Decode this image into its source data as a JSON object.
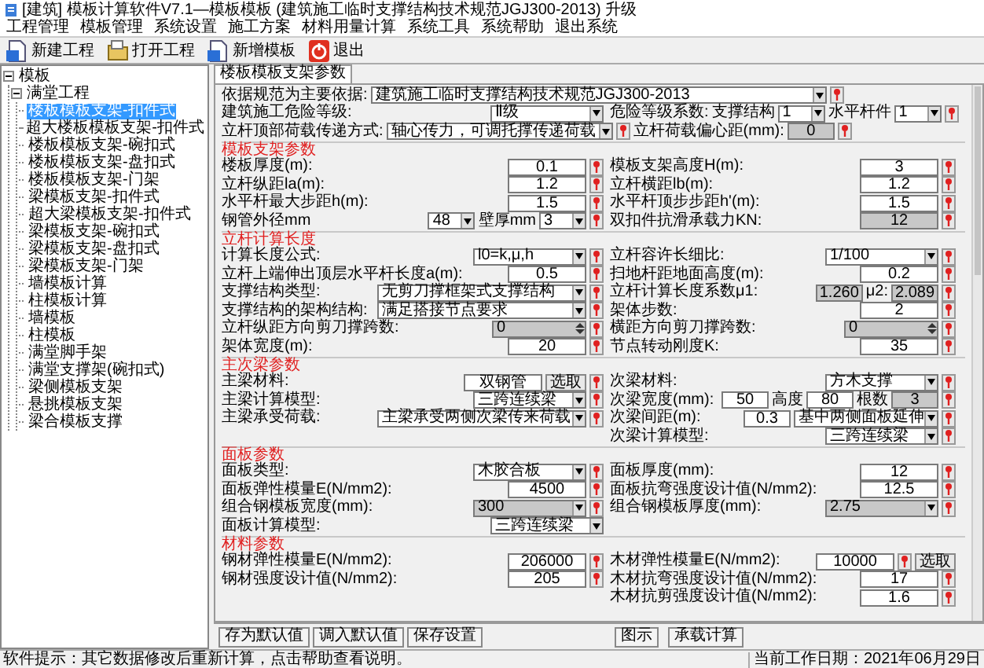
{
  "window": {
    "title": "[建筑] 模板计算软件V7.1—模板模板 (建筑施工临时支撑结构技术规范JGJ300-2013) 升级"
  },
  "menu": [
    "工程管理",
    "模板管理",
    "系统设置",
    "施工方案",
    "材料用量计算",
    "系统工具",
    "系统帮助",
    "退出系统"
  ],
  "toolbar": [
    {
      "kind": "new",
      "label": "新建工程"
    },
    {
      "kind": "open",
      "label": "打开工程"
    },
    {
      "kind": "new",
      "label": "新增模板"
    },
    {
      "kind": "exit",
      "label": "退出"
    }
  ],
  "tree": [
    {
      "label": "模板",
      "expanded": true,
      "selected": false,
      "children": [
        {
          "label": "满堂工程",
          "expanded": true,
          "selected": false,
          "children": [
            {
              "label": "楼板模板支架-扣件式",
              "selected": true
            },
            {
              "label": "超大楼板模板支架-扣件式",
              "selected": false
            },
            {
              "label": "楼板模板支架-碗扣式",
              "selected": false
            },
            {
              "label": "楼板模板支架-盘扣式",
              "selected": false
            },
            {
              "label": "楼板模板支架-门架",
              "selected": false
            },
            {
              "label": "梁模板支架-扣件式",
              "selected": false
            },
            {
              "label": "超大梁模板支架-扣件式",
              "selected": false
            },
            {
              "label": "梁模板支架-碗扣式",
              "selected": false
            },
            {
              "label": "梁模板支架-盘扣式",
              "selected": false
            },
            {
              "label": "梁模板支架-门架",
              "selected": false
            },
            {
              "label": "墙模板计算",
              "selected": false
            },
            {
              "label": "柱模板计算",
              "selected": false
            },
            {
              "label": "墙模板",
              "selected": false
            },
            {
              "label": "柱模板",
              "selected": false
            },
            {
              "label": "满堂脚手架",
              "selected": false
            },
            {
              "label": "满堂支撑架(碗扣式)",
              "selected": false
            },
            {
              "label": "梁侧模板支架",
              "selected": false
            },
            {
              "label": "悬挑模板支架",
              "selected": false
            },
            {
              "label": "梁合模板支撑",
              "selected": false
            }
          ]
        }
      ]
    }
  ],
  "tab": {
    "label": "楼板模板支架参数",
    "selected": true
  },
  "sections": [
    {
      "rows": [
        {
          "full": [
            {
              "kind": "label",
              "text": "依据规范为主要依据:"
            },
            {
              "kind": "fullselect",
              "value": "建筑施工临时支撑结构技术规范JGJ300-2013",
              "disabled": false
            },
            {
              "kind": "help"
            }
          ]
        },
        {
          "left": [
            {
              "kind": "label",
              "text": "建筑施工危险等级:"
            },
            {
              "kind": "select",
              "value": "Ⅱ级",
              "disabled": false
            }
          ],
          "right": [
            {
              "kind": "label",
              "text": "危险等级系数:"
            },
            {
              "kind": "label",
              "text": "支撑结构"
            },
            {
              "kind": "tinyselect",
              "value": "1",
              "disabled": false
            },
            {
              "kind": "label",
              "text": "水平杆件"
            },
            {
              "kind": "tinyselect",
              "value": "1",
              "disabled": false
            },
            {
              "kind": "help"
            }
          ]
        },
        {
          "full": [
            {
              "kind": "label",
              "text": "立杆顶部荷载传递方式:"
            },
            {
              "kind": "longselect",
              "value": "轴心传力，可调托撑传递荷载",
              "disabled": false
            },
            {
              "kind": "help"
            },
            {
              "kind": "label",
              "text": "立杆荷载偏心距(mm):"
            },
            {
              "kind": "tiny",
              "value": "0",
              "disabled": true
            },
            {
              "kind": "help"
            }
          ]
        }
      ]
    },
    {
      "heading": "模板支架参数",
      "rows": [
        {
          "left": [
            {
              "kind": "label",
              "text": "楼板厚度(m):"
            },
            {
              "kind": "field",
              "value": "0.1",
              "disabled": false
            },
            {
              "kind": "help"
            }
          ],
          "right": [
            {
              "kind": "label",
              "text": "模板支架高度H(m):"
            },
            {
              "kind": "field",
              "value": "3",
              "disabled": false
            },
            {
              "kind": "help"
            }
          ]
        },
        {
          "left": [
            {
              "kind": "label",
              "text": "立杆纵距la(m):"
            },
            {
              "kind": "field",
              "value": "1.2",
              "disabled": false
            },
            {
              "kind": "help"
            }
          ],
          "right": [
            {
              "kind": "label",
              "text": "立杆横距lb(m):"
            },
            {
              "kind": "field",
              "value": "1.2",
              "disabled": false
            },
            {
              "kind": "help"
            }
          ]
        },
        {
          "left": [
            {
              "kind": "label",
              "text": "水平杆最大步距h(m):"
            },
            {
              "kind": "field",
              "value": "1.5",
              "disabled": false
            },
            {
              "kind": "help"
            }
          ],
          "right": [
            {
              "kind": "label",
              "text": "水平杆顶步步距h'(m):"
            },
            {
              "kind": "field",
              "value": "1.5",
              "disabled": false
            },
            {
              "kind": "help"
            }
          ]
        },
        {
          "left": [
            {
              "kind": "label",
              "text": "钢管外径mm"
            },
            {
              "kind": "tinyselect",
              "value": "48",
              "disabled": false
            },
            {
              "kind": "label",
              "text": "壁厚mm"
            },
            {
              "kind": "tinyselect",
              "value": "3",
              "disabled": false
            },
            {
              "kind": "help"
            }
          ],
          "right": [
            {
              "kind": "label",
              "text": "双扣件抗滑承载力KN:"
            },
            {
              "kind": "field",
              "value": "12",
              "disabled": true
            },
            {
              "kind": "help"
            }
          ]
        }
      ]
    },
    {
      "heading": "立杆计算长度",
      "rows": [
        {
          "left": [
            {
              "kind": "label",
              "text": "计算长度公式:"
            },
            {
              "kind": "select",
              "value": "l0=k,μ,h",
              "disabled": false
            },
            {
              "kind": "help"
            }
          ],
          "right": [
            {
              "kind": "label",
              "text": "立杆容许长细比:"
            },
            {
              "kind": "select",
              "value": "1/100",
              "disabled": false
            },
            {
              "kind": "help"
            }
          ]
        },
        {
          "left": [
            {
              "kind": "label",
              "text": "立杆上端伸出顶层水平杆长度a(m):"
            },
            {
              "kind": "field",
              "value": "0.5",
              "disabled": false
            },
            {
              "kind": "help"
            }
          ],
          "right": [
            {
              "kind": "label",
              "text": "扫地杆距地面高度(m):"
            },
            {
              "kind": "field",
              "value": "0.2",
              "disabled": false
            },
            {
              "kind": "help"
            }
          ]
        },
        {
          "left": [
            {
              "kind": "label",
              "text": "支撑结构类型:"
            },
            {
              "kind": "wideselect",
              "value": "无剪刀撑框架式支撑结构",
              "disabled": false
            },
            {
              "kind": "help"
            }
          ],
          "right": [
            {
              "kind": "label",
              "text": "立杆计算长度系数μ1:"
            },
            {
              "kind": "tiny",
              "value": "1.260",
              "disabled": true
            },
            {
              "kind": "label",
              "text": "μ2:"
            },
            {
              "kind": "tiny",
              "value": "2.089",
              "disabled": true
            },
            {
              "kind": "help"
            }
          ]
        },
        {
          "left": [
            {
              "kind": "label",
              "text": "支撑结构的架构结构:"
            },
            {
              "kind": "wideselect",
              "value": "满足搭接节点要求",
              "disabled": false
            },
            {
              "kind": "help"
            }
          ],
          "right": [
            {
              "kind": "label",
              "text": "架体步数:"
            },
            {
              "kind": "field",
              "value": "2",
              "disabled": false
            },
            {
              "kind": "help"
            }
          ]
        },
        {
          "left": [
            {
              "kind": "label",
              "text": "立杆纵距方向剪刀撑跨数:"
            },
            {
              "kind": "spinner",
              "value": "0",
              "disabled": true
            },
            {
              "kind": "help"
            }
          ],
          "right": [
            {
              "kind": "label",
              "text": "横距方向剪刀撑跨数:"
            },
            {
              "kind": "spinner",
              "value": "0",
              "disabled": true
            },
            {
              "kind": "help"
            }
          ]
        },
        {
          "left": [
            {
              "kind": "label",
              "text": "架体宽度(m):"
            },
            {
              "kind": "field",
              "value": "20",
              "disabled": false
            },
            {
              "kind": "help"
            }
          ],
          "right": [
            {
              "kind": "label",
              "text": "节点转动刚度K:"
            },
            {
              "kind": "field",
              "value": "35",
              "disabled": false
            },
            {
              "kind": "help"
            }
          ]
        }
      ]
    },
    {
      "heading": "主次梁参数",
      "rows": [
        {
          "left": [
            {
              "kind": "label",
              "text": "主梁材料:"
            },
            {
              "kind": "field",
              "value": "双钢管",
              "disabled": false
            },
            {
              "kind": "button",
              "value": "选取",
              "disabled": false
            },
            {
              "kind": "help"
            }
          ],
          "right": [
            {
              "kind": "label",
              "text": "次梁材料:"
            },
            {
              "kind": "select",
              "value": "方木支撑",
              "disabled": false
            },
            {
              "kind": "help"
            }
          ]
        },
        {
          "left": [
            {
              "kind": "label",
              "text": "主梁计算模型:"
            },
            {
              "kind": "select",
              "value": "三跨连续梁",
              "disabled": false
            },
            {
              "kind": "help"
            }
          ],
          "right": [
            {
              "kind": "label",
              "text": "次梁宽度(mm):"
            },
            {
              "kind": "tiny",
              "value": "50",
              "disabled": false
            },
            {
              "kind": "label",
              "text": "高度"
            },
            {
              "kind": "tiny",
              "value": "80",
              "disabled": false
            },
            {
              "kind": "label",
              "text": "根数"
            },
            {
              "kind": "tiny",
              "value": "3",
              "disabled": true
            },
            {
              "kind": "help"
            }
          ]
        },
        {
          "left": [
            {
              "kind": "label",
              "text": "主梁承受荷载:"
            },
            {
              "kind": "wideselect",
              "value": "主梁承受两侧次梁传来荷载",
              "disabled": false
            },
            {
              "kind": "help"
            }
          ],
          "right": [
            {
              "kind": "label",
              "text": "次梁间距(m):"
            },
            {
              "kind": "tiny",
              "value": "0.3",
              "disabled": false
            },
            {
              "kind": "midselect",
              "value": "基中两侧面板延伸",
              "disabled": false
            },
            {
              "kind": "help"
            }
          ]
        },
        {
          "right": [
            {
              "kind": "label",
              "text": "次梁计算模型:"
            },
            {
              "kind": "select",
              "value": "三跨连续梁",
              "disabled": false
            },
            {
              "kind": "help"
            }
          ]
        }
      ]
    },
    {
      "heading": "面板参数",
      "rows": [
        {
          "left": [
            {
              "kind": "label",
              "text": "面板类型:"
            },
            {
              "kind": "select",
              "value": "木胶合板",
              "disabled": false
            },
            {
              "kind": "help"
            }
          ],
          "right": [
            {
              "kind": "label",
              "text": "面板厚度(mm):"
            },
            {
              "kind": "field",
              "value": "12",
              "disabled": false
            },
            {
              "kind": "help"
            }
          ]
        },
        {
          "left": [
            {
              "kind": "label",
              "text": "面板弹性模量E(N/mm2):"
            },
            {
              "kind": "field",
              "value": "4500",
              "disabled": false
            },
            {
              "kind": "help"
            }
          ],
          "right": [
            {
              "kind": "label",
              "text": "面板抗弯强度设计值(N/mm2):"
            },
            {
              "kind": "field",
              "value": "12.5",
              "disabled": false
            },
            {
              "kind": "help"
            }
          ]
        },
        {
          "left": [
            {
              "kind": "label",
              "text": "组合钢模板宽度(mm):"
            },
            {
              "kind": "select",
              "value": "300",
              "disabled": true
            },
            {
              "kind": "help"
            }
          ],
          "right": [
            {
              "kind": "label",
              "text": "组合钢模板厚度(mm):"
            },
            {
              "kind": "select",
              "value": "2.75",
              "disabled": true
            },
            {
              "kind": "help"
            }
          ]
        },
        {
          "left": [
            {
              "kind": "label",
              "text": "面板计算模型:"
            },
            {
              "kind": "select",
              "value": "三跨连续梁",
              "disabled": false
            }
          ]
        }
      ]
    },
    {
      "heading": "材料参数",
      "rows": [
        {
          "left": [
            {
              "kind": "label",
              "text": "钢材弹性模量E(N/mm2):"
            },
            {
              "kind": "field",
              "value": "206000",
              "disabled": false
            },
            {
              "kind": "help"
            }
          ],
          "right": [
            {
              "kind": "label",
              "text": "木材弹性模量E(N/mm2):"
            },
            {
              "kind": "field",
              "value": "10000",
              "disabled": false
            },
            {
              "kind": "help"
            },
            {
              "kind": "button",
              "value": "选取",
              "disabled": false
            }
          ]
        },
        {
          "left": [
            {
              "kind": "label",
              "text": "钢材强度设计值(N/mm2):"
            },
            {
              "kind": "field",
              "value": "205",
              "disabled": false
            },
            {
              "kind": "help"
            }
          ],
          "right": [
            {
              "kind": "label",
              "text": "木材抗弯强度设计值(N/mm2):"
            },
            {
              "kind": "field",
              "value": "17",
              "disabled": false
            },
            {
              "kind": "help"
            }
          ]
        },
        {
          "right": [
            {
              "kind": "label",
              "text": "木材抗剪强度设计值(N/mm2):"
            },
            {
              "kind": "field",
              "value": "1.6",
              "disabled": false
            },
            {
              "kind": "help"
            }
          ]
        }
      ]
    }
  ],
  "bottom_buttons_left": [
    "存为默认值",
    "调入默认值",
    "保存设置"
  ],
  "bottom_buttons_right": [
    "图示",
    "承载计算"
  ],
  "status_bar": {
    "hint": "软件提示：其它数据修改后重新计算，点击帮助查看说明。",
    "date": "当前工作日期：2021年06月29日"
  }
}
